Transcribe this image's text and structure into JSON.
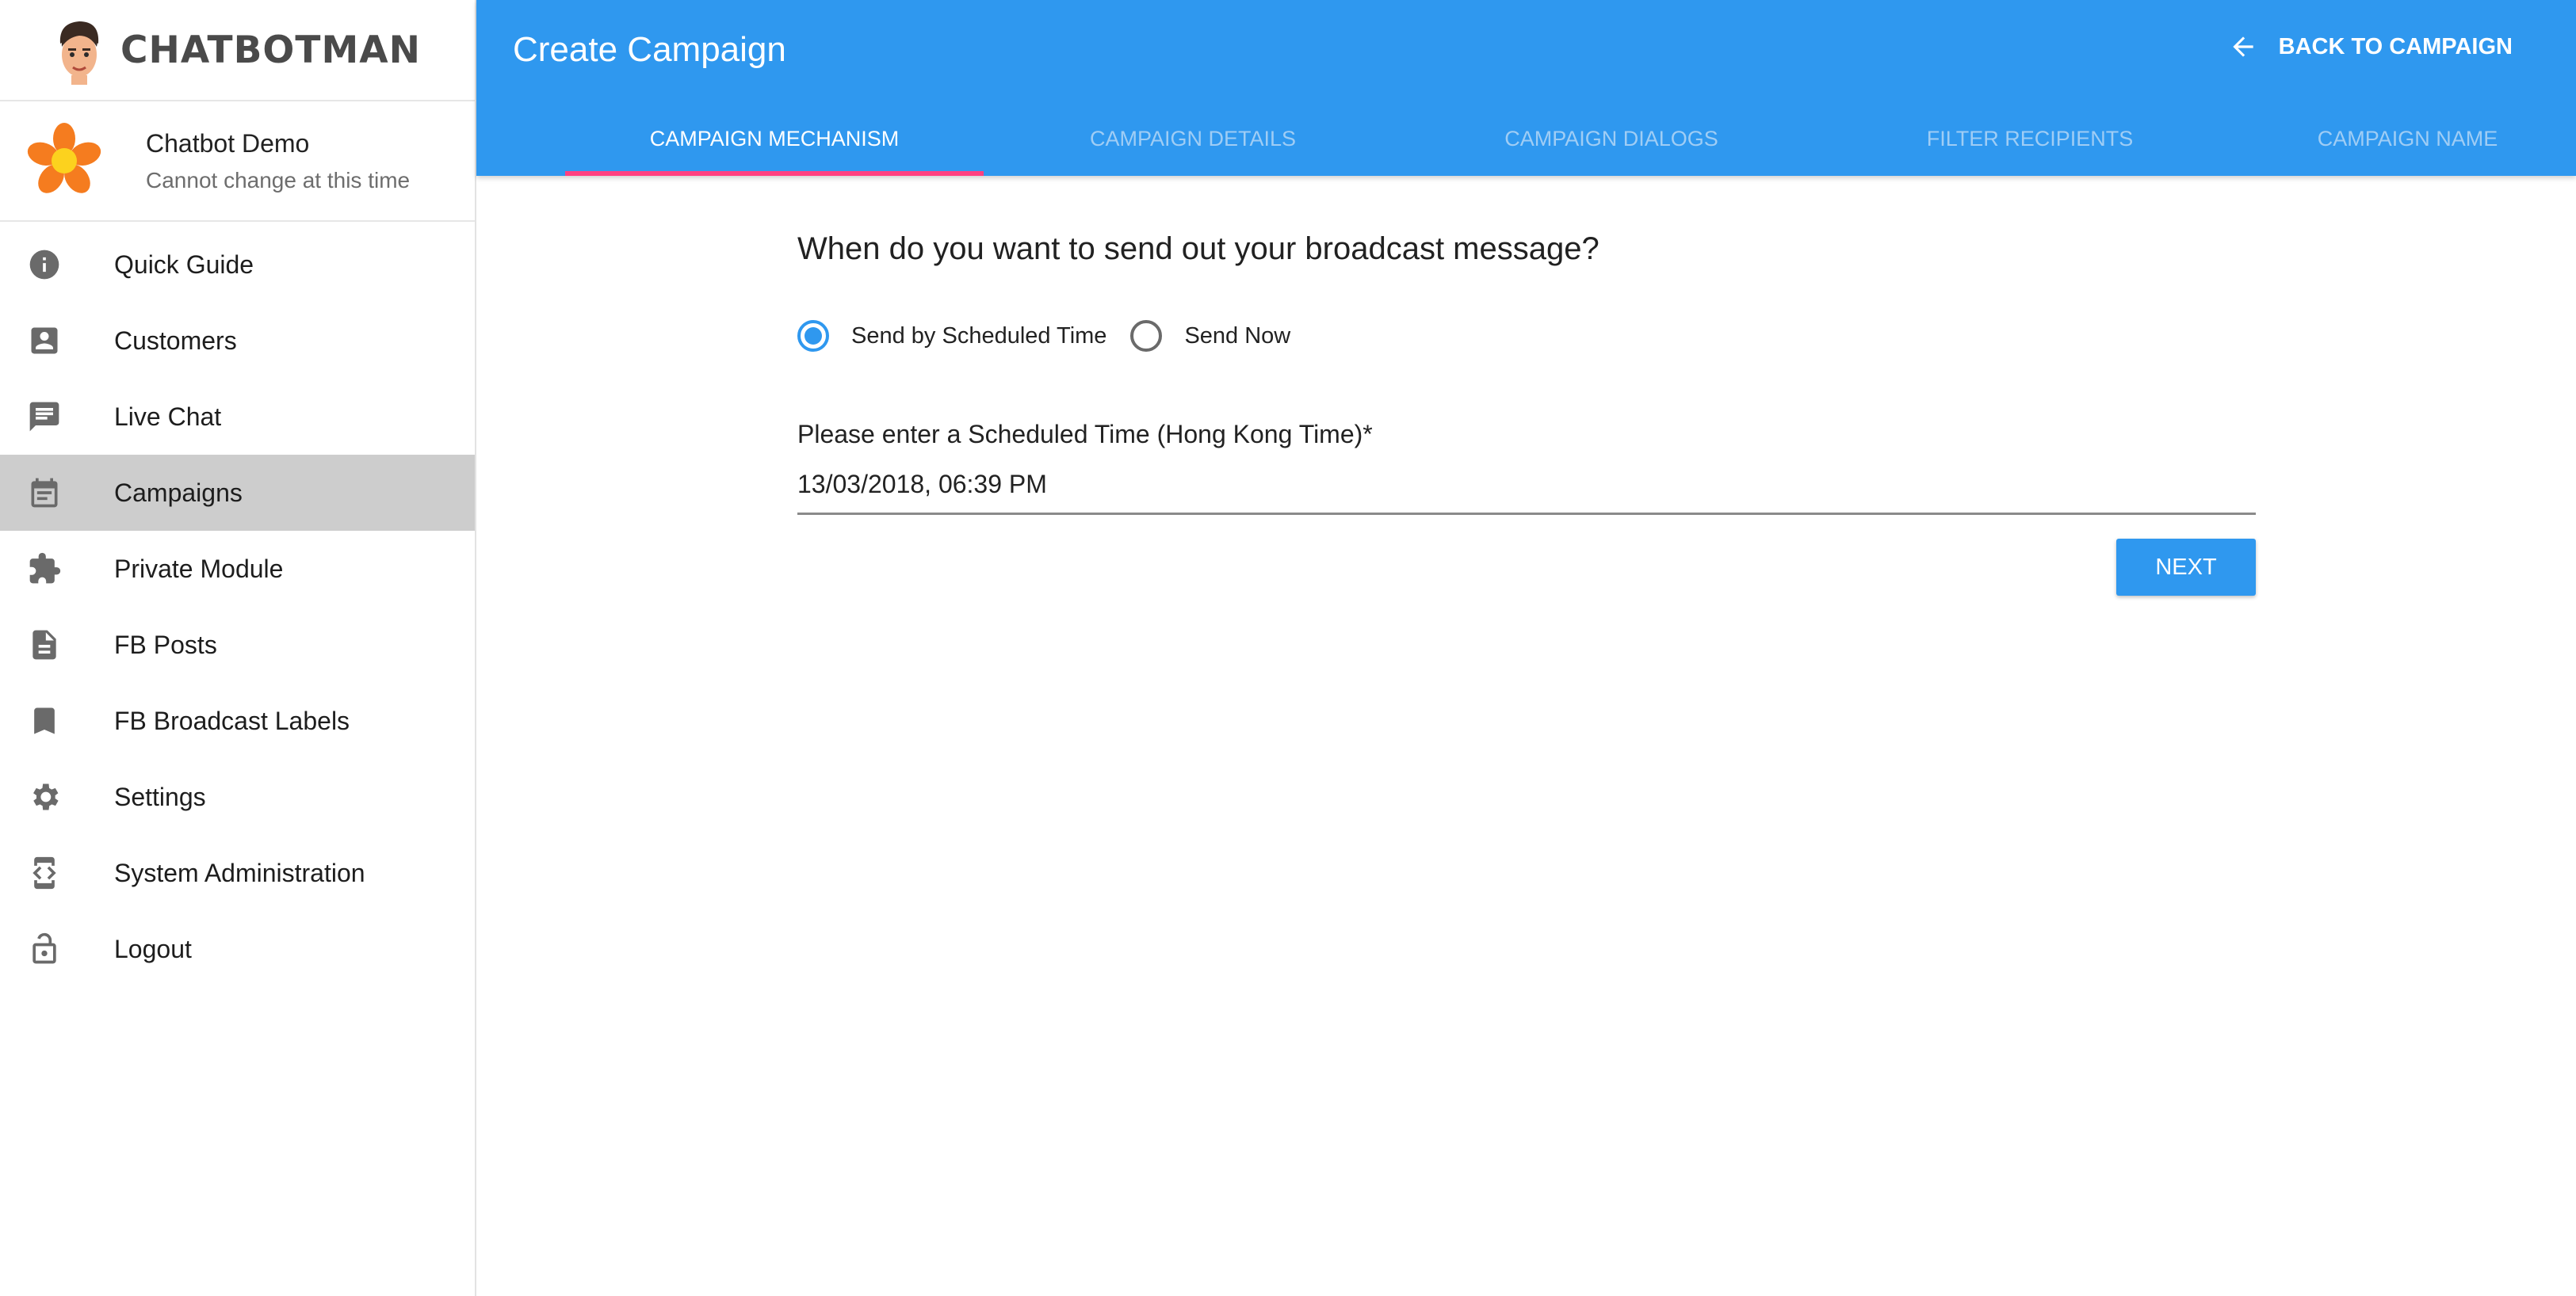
{
  "brand": {
    "name": "CHATBOTMAN"
  },
  "account": {
    "name": "Chatbot Demo",
    "subtitle": "Cannot change at this time"
  },
  "sidebar": {
    "items": [
      {
        "label": "Quick Guide",
        "icon": "info-icon"
      },
      {
        "label": "Customers",
        "icon": "contact-card-icon"
      },
      {
        "label": "Live Chat",
        "icon": "chat-icon"
      },
      {
        "label": "Campaigns",
        "icon": "calendar-icon",
        "active": true
      },
      {
        "label": "Private Module",
        "icon": "puzzle-icon"
      },
      {
        "label": "FB Posts",
        "icon": "document-icon"
      },
      {
        "label": "FB Broadcast Labels",
        "icon": "bookmark-icon"
      },
      {
        "label": "Settings",
        "icon": "gear-icon"
      },
      {
        "label": "System Administration",
        "icon": "developer-mode-icon"
      },
      {
        "label": "Logout",
        "icon": "lock-open-icon"
      }
    ]
  },
  "header": {
    "title": "Create Campaign",
    "back_label": "BACK TO CAMPAIGN",
    "tabs": [
      {
        "label": "CAMPAIGN MECHANISM",
        "active": true
      },
      {
        "label": "CAMPAIGN DETAILS"
      },
      {
        "label": "CAMPAIGN DIALOGS"
      },
      {
        "label": "FILTER RECIPIENTS"
      },
      {
        "label": "CAMPAIGN NAME"
      }
    ]
  },
  "form": {
    "question": "When do you want to send out your broadcast message?",
    "options": [
      {
        "label": "Send by Scheduled Time",
        "checked": true
      },
      {
        "label": "Send Now",
        "checked": false
      }
    ],
    "time_label": "Please enter a Scheduled Time (Hong Kong Time)*",
    "time_value": "13/03/2018, 06:39 PM",
    "next_label": "NEXT"
  },
  "colors": {
    "primary": "#2f98ef",
    "tab_indicator": "#ff4081",
    "active_nav_bg": "#cdcdcd"
  }
}
